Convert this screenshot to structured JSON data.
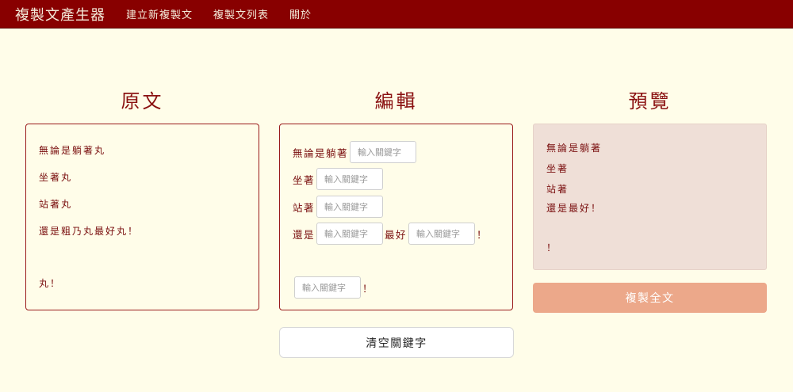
{
  "navbar": {
    "brand": "複製文產生器",
    "links": [
      "建立新複製文",
      "複製文列表",
      "關於"
    ]
  },
  "columns": {
    "original_title": "原文",
    "edit_title": "編輯",
    "preview_title": "預覽"
  },
  "original": {
    "lines": [
      "無論是躺著丸",
      "坐著丸",
      "站著丸",
      "還是粗乃丸最好丸！",
      "丸！"
    ]
  },
  "edit": {
    "placeholder": "輸入關鍵字",
    "rows": [
      {
        "prefix": "無論是躺著"
      },
      {
        "prefix": "坐著"
      },
      {
        "prefix": "站著"
      },
      {
        "prefix": "還是",
        "middle": "最好",
        "suffix": "！"
      },
      {
        "suffix": "！"
      }
    ]
  },
  "preview": {
    "lines": [
      "無論是躺著",
      "坐著",
      "站著",
      "還是最好！",
      "！"
    ]
  },
  "buttons": {
    "copy_all": "複製全文",
    "clear_keywords": "清空關鍵字"
  },
  "colors": {
    "navbar": "#880000",
    "background": "#fffde9",
    "accent": "#eca88a",
    "preview_bg": "#efdfd7"
  }
}
